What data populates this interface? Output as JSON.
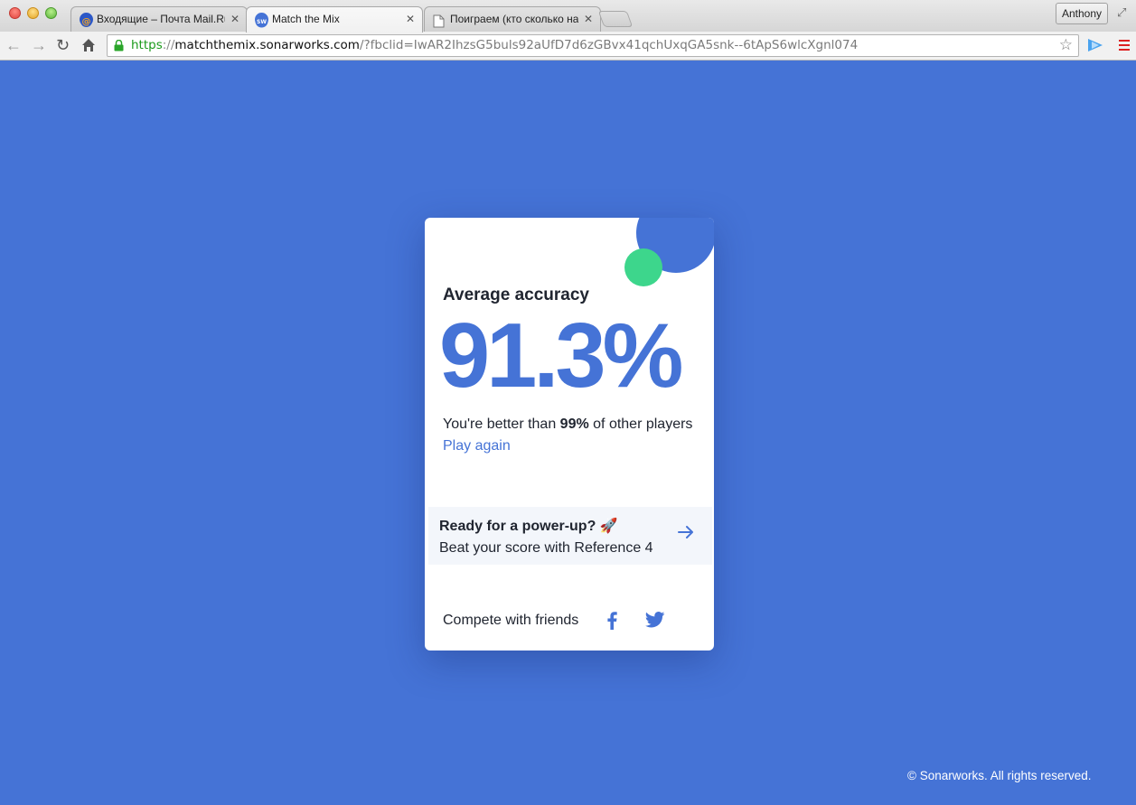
{
  "browser": {
    "tabs": [
      {
        "title": "Входящие – Почта Mail.Ru",
        "active": false,
        "icon": "mailru-icon"
      },
      {
        "title": "Match the Mix",
        "active": true,
        "icon": "sonarworks-icon"
      },
      {
        "title": "Поиграем (кто сколько наберет)",
        "active": false,
        "icon": "document-icon"
      }
    ],
    "tab_close": "✕",
    "profile_name": "Anthony",
    "url": {
      "scheme": "https",
      "separator": "://",
      "host": "matchthemix.sonarworks.com",
      "path": "/?fbclid=IwAR2IhzsG5buls92aUfD7d6zGBvx41qchUxqGA5snk--6tApS6wlcXgnl074"
    },
    "sonarworks_badge": "SW"
  },
  "card": {
    "accuracy_label": "Average accuracy",
    "accuracy_value": "91.3%",
    "better_prefix": "You're better than ",
    "better_percent": "99%",
    "better_suffix": " of other players",
    "play_again": "Play again",
    "promo_title": "Ready for a power-up? 🚀",
    "promo_subtitle": "Beat your score with Reference 4",
    "compete_label": "Compete with friends"
  },
  "footer": "© Sonarworks. All rights reserved.",
  "colors": {
    "background": "#4573d6",
    "accent_blue": "#4573d6",
    "accent_green": "#3dd68c",
    "text_dark": "#202530"
  }
}
